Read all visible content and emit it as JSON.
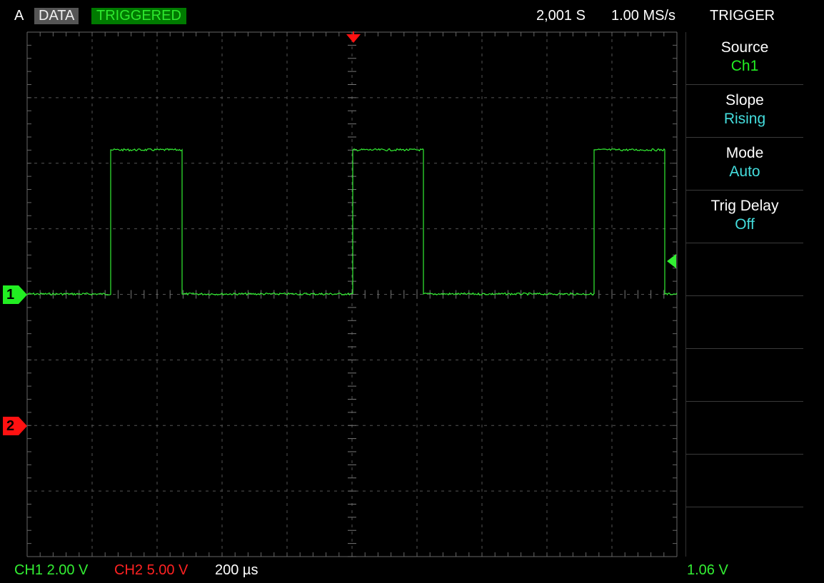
{
  "header": {
    "channel_letter": "A",
    "data_badge": "DATA",
    "status_badge": "TRIGGERED",
    "sample_count": "2,001 S",
    "sample_rate": "1.00 MS/s",
    "panel_title": "TRIGGER"
  },
  "menu": {
    "items": [
      {
        "label": "Source",
        "value": "Ch1",
        "value_color": "#22ee22"
      },
      {
        "label": "Slope",
        "value": "Rising",
        "value_color": "#44dddd"
      },
      {
        "label": "Mode",
        "value": "Auto",
        "value_color": "#44dddd"
      },
      {
        "label": "Trig Delay",
        "value": "Off",
        "value_color": "#44dddd"
      }
    ]
  },
  "footer": {
    "ch1_scale": "CH1 2.00 V",
    "ch2_scale": "CH2 5.00 V",
    "timebase": "200 µs",
    "trigger_level": "1.06 V"
  },
  "markers": {
    "ch1_label": "1",
    "ch2_label": "2"
  },
  "colors": {
    "ch1": "#33ee33",
    "ch2": "#ff1111",
    "grid": "#555555",
    "triggered_bg": "#007a00",
    "data_bg": "#555555"
  }
}
